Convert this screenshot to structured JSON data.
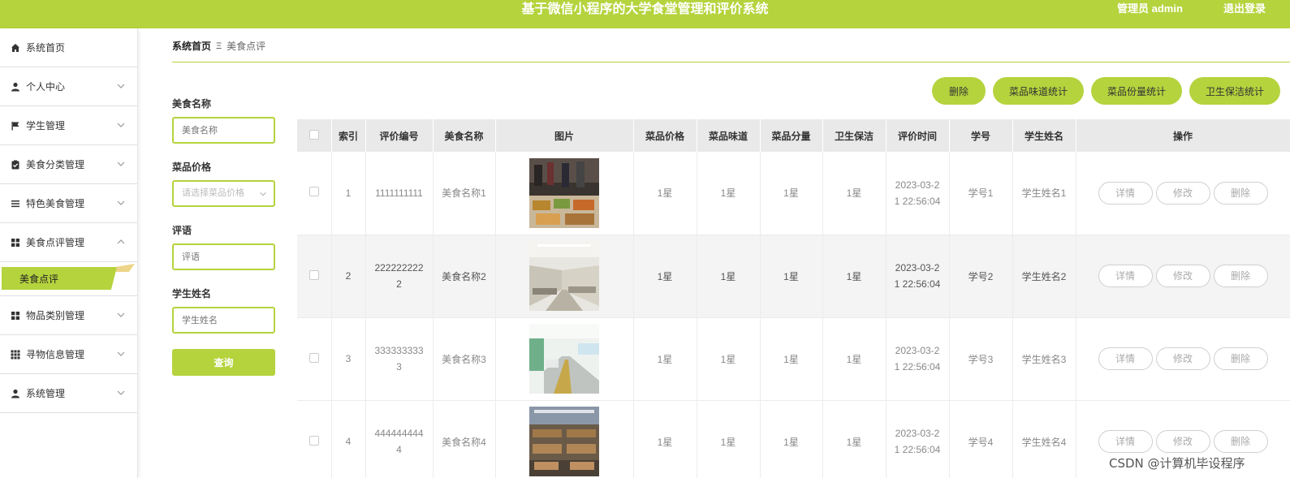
{
  "header": {
    "title": "基于微信小程序的大学食堂管理和评价系统",
    "admin_label": "管理员 admin",
    "logout_label": "退出登录",
    "bg_color": "#b5d33d"
  },
  "sidebar": {
    "items": [
      {
        "label": "系统首页",
        "icon": "home-icon"
      },
      {
        "label": "个人中心",
        "icon": "user-icon"
      },
      {
        "label": "学生管理",
        "icon": "flag-icon"
      },
      {
        "label": "美食分类管理",
        "icon": "clipboard-check-icon"
      },
      {
        "label": "特色美食管理",
        "icon": "list-icon"
      },
      {
        "label": "美食点评管理",
        "icon": "grid-icon"
      },
      {
        "label": "物品类别管理",
        "icon": "grid-icon"
      },
      {
        "label": "寻物信息管理",
        "icon": "apps-icon"
      },
      {
        "label": "系统管理",
        "icon": "user-icon"
      }
    ],
    "active_sub_item": "美食点评"
  },
  "breadcrumb": {
    "home": "系统首页",
    "separator": "Ξ",
    "current": "美食点评"
  },
  "search": {
    "name_label": "美食名称",
    "name_placeholder": "美食名称",
    "price_label": "菜品价格",
    "price_placeholder": "请选择菜品价格",
    "comment_label": "评语",
    "comment_placeholder": "评语",
    "student_label": "学生姓名",
    "student_placeholder": "学生姓名",
    "query_button": "查询"
  },
  "actions": {
    "delete": "删除",
    "taste_stats": "菜品味道统计",
    "portion_stats": "菜品份量统计",
    "hygiene_stats": "卫生保洁统计"
  },
  "table": {
    "headers": [
      "",
      "索引",
      "评价编号",
      "美食名称",
      "图片",
      "菜品价格",
      "菜品味道",
      "菜品分量",
      "卫生保洁",
      "评价时间",
      "学号",
      "学生姓名",
      "操作"
    ],
    "ops": {
      "detail": "详情",
      "edit": "修改",
      "delete": "删除"
    },
    "rows": [
      {
        "index": "1",
        "code": "1111111111",
        "name": "美食名称1",
        "image": "cafeteria-buffet-photo",
        "price": "1星",
        "taste": "1星",
        "portion": "1星",
        "hygiene": "1星",
        "time": "2023-03-21 22:56:04",
        "student_no": "学号1",
        "student_name": "学生姓名1"
      },
      {
        "index": "2",
        "code": "2222222222",
        "name": "美食名称2",
        "image": "canteen-hall-photo",
        "price": "1星",
        "taste": "1星",
        "portion": "1星",
        "hygiene": "1星",
        "time": "2023-03-21 22:56:04",
        "student_no": "学号2",
        "student_name": "学生姓名2"
      },
      {
        "index": "3",
        "code": "3333333333",
        "name": "美食名称3",
        "image": "canteen-counter-photo",
        "price": "1星",
        "taste": "1星",
        "portion": "1星",
        "hygiene": "1星",
        "time": "2023-03-21 22:56:04",
        "student_no": "学号3",
        "student_name": "学生姓名3"
      },
      {
        "index": "4",
        "code": "4444444444",
        "name": "美食名称4",
        "image": "dining-tables-photo",
        "price": "1星",
        "taste": "1星",
        "portion": "1星",
        "hygiene": "1星",
        "time": "2023-03-21 22:56:04",
        "student_no": "学号4",
        "student_name": "学生姓名4"
      }
    ]
  },
  "watermark": "CSDN @计算机毕设程序"
}
